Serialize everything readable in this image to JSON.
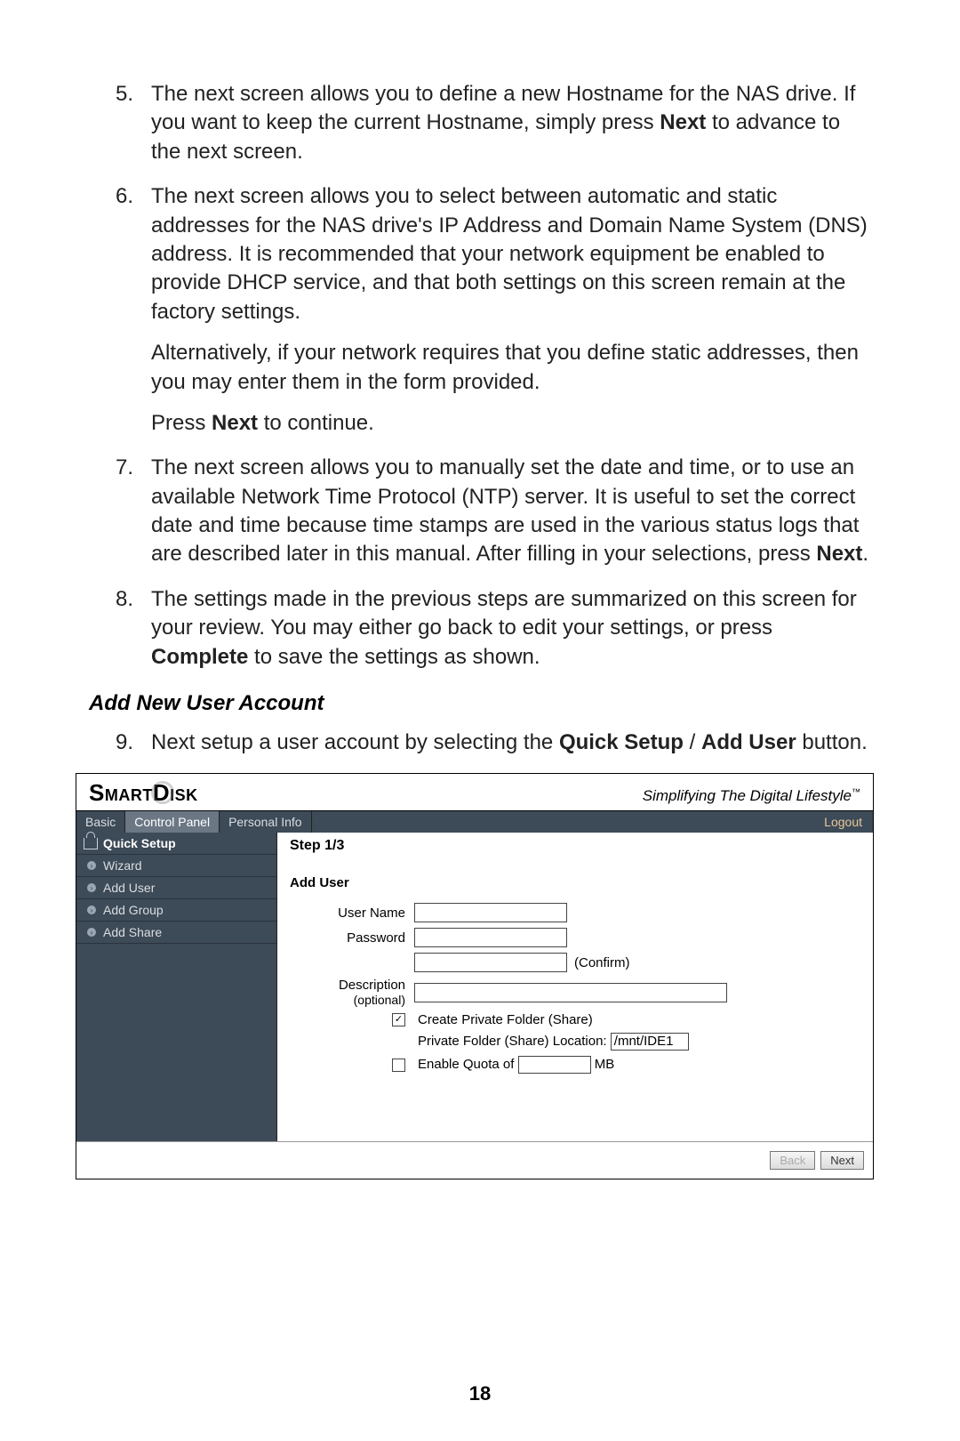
{
  "manual": {
    "items": [
      {
        "num": "5.",
        "paras": [
          "The next screen allows you to define a new Hostname for the NAS drive. If you want to keep the current Hostname, simply press <b>Next</b> to advance to the next screen."
        ]
      },
      {
        "num": "6.",
        "paras": [
          "The next screen allows you to select between automatic and static addresses for the NAS drive's IP Address and Domain Name System (DNS) address. It is recommended that your network equipment be enabled to provide DHCP service, and that both settings on this screen remain at the factory settings.",
          "Alternatively, if your network requires that you define static addresses, then you may enter them in the form provided.",
          "Press <b>Next</b> to continue."
        ]
      },
      {
        "num": "7.",
        "paras": [
          "The next screen allows you to manually set the date and time, or to use an available Network Time Protocol (NTP) server. It is useful to set the correct date and time because time stamps are used in the various status logs that are described later in this manual. After filling in your selections, press <b>Next</b>."
        ]
      },
      {
        "num": "8.",
        "paras": [
          "The settings made in the previous steps are summarized on this screen for your review. You may either go back to edit your settings, or press <b>Complete</b> to save the settings as shown."
        ]
      }
    ],
    "section_title": "Add New User Account",
    "items2": [
      {
        "num": "9.",
        "paras": [
          "Next setup a user account by selecting the <b>Quick Setup</b> / <b>Add User</b> button."
        ]
      }
    ]
  },
  "shot": {
    "brand_left": "Smart",
    "brand_right": "Disk",
    "tagline": "Simplifying The Digital Lifestyle",
    "tabs": {
      "basic": "Basic",
      "control": "Control Panel",
      "personal": "Personal Info",
      "logout": "Logout"
    },
    "sidebar": {
      "heading": "Quick Setup",
      "items": [
        "Wizard",
        "Add User",
        "Add Group",
        "Add Share"
      ]
    },
    "step": "Step 1/3",
    "form_title": "Add User",
    "labels": {
      "user": "User Name",
      "pass": "Password",
      "confirm": "(Confirm)",
      "desc": "Description",
      "desc_sub": "(optional)",
      "create_pf": "Create Private Folder (Share)",
      "pf_loc_label": "Private Folder (Share) Location:",
      "pf_loc_value": "/mnt/IDE1",
      "enable_quota": "Enable Quota of",
      "mb": "MB"
    },
    "checks": {
      "create_pf": true,
      "enable_quota": false
    },
    "buttons": {
      "back": "Back",
      "next": "Next"
    }
  },
  "page_number": "18"
}
